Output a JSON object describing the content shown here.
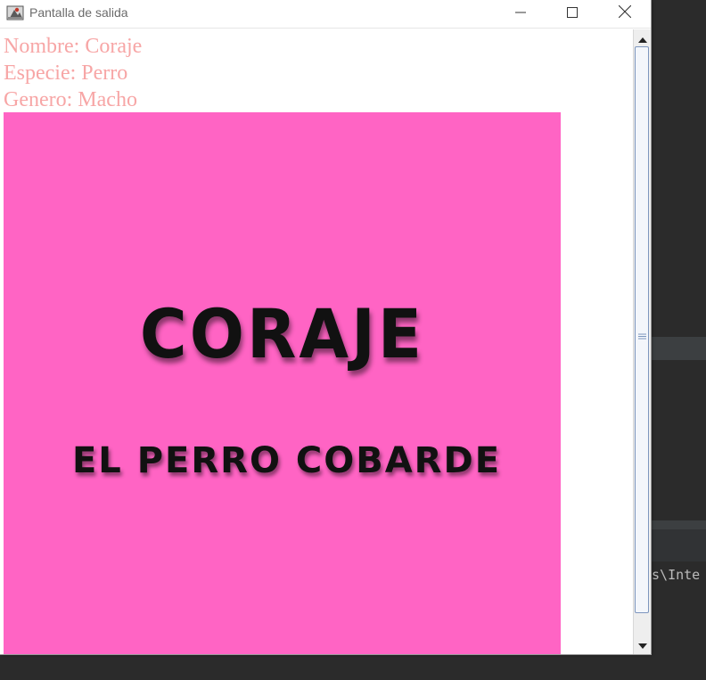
{
  "window": {
    "title": "Pantalla de salida",
    "controls": [
      "minimize",
      "maximize",
      "close"
    ]
  },
  "pet_info": {
    "name_line": "Nombre: Coraje",
    "species_line": "Especie: Perro",
    "gender_line": "Genero: Macho",
    "text_color": "#f7a6a6"
  },
  "poster": {
    "title": "CORAJE",
    "subtitle": "EL PERRO COBARDE",
    "background": "#ff64c4"
  },
  "background_ide": {
    "console_text": "ms\\Inte"
  },
  "icons": [
    "java-app-icon",
    "minimize-icon",
    "maximize-icon",
    "close-icon",
    "scroll-up-icon",
    "scroll-down-icon",
    "scroll-grip-icon"
  ]
}
